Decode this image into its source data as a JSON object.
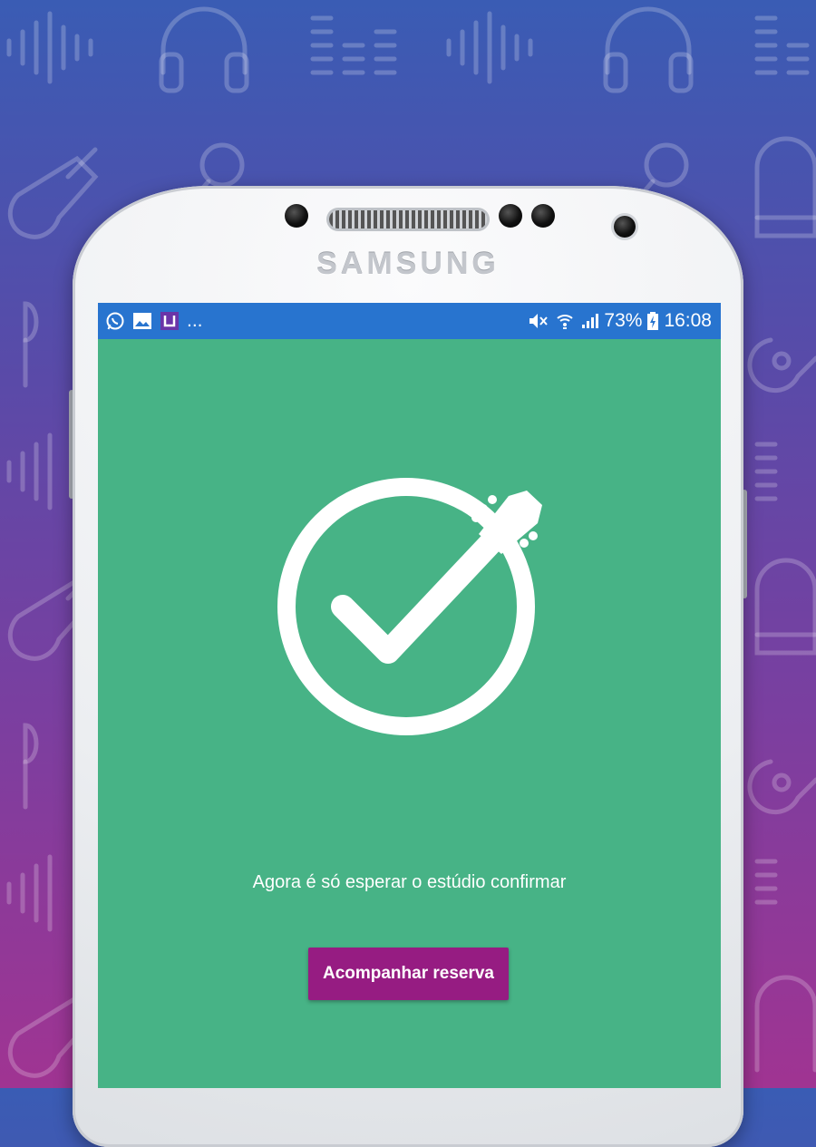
{
  "device": {
    "brand": "SAMSUNG"
  },
  "status_bar": {
    "left_icons": [
      "whatsapp-icon",
      "image-icon",
      "app-icon"
    ],
    "overflow": "...",
    "right_icons": [
      "mute-icon",
      "wifi-icon",
      "signal-icon",
      "battery-charging-icon"
    ],
    "battery": "73%",
    "time": "16:08",
    "color": "#2874cf"
  },
  "screen": {
    "background_color": "#47b386",
    "hero_icon": "guitar-check-icon",
    "message": "Agora é só esperar o estúdio confirmar",
    "button_label": "Acompanhar reserva",
    "button_color": "#961c82"
  },
  "background": {
    "pattern_icons": [
      "sound-wave-icon",
      "headphones-icon",
      "equalizer-icon",
      "guitar-icon",
      "microphone-icon",
      "piano-icon",
      "earphones-icon"
    ]
  }
}
